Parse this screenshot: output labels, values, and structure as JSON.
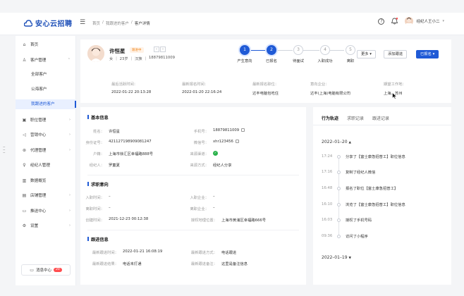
{
  "app": {
    "logo_text": "安心云招聘"
  },
  "breadcrumb": [
    "首页",
    "我跟进的客户",
    "客户详情"
  ],
  "topbar": {
    "user_name": "经纪人王小二"
  },
  "sidebar": {
    "items": [
      {
        "label": "首页",
        "icon": "home-icon"
      },
      {
        "label": "客户管理",
        "icon": "user-icon",
        "chevron": "^"
      },
      {
        "label": "职位管理",
        "icon": "briefcase-icon",
        "chevron": ">"
      },
      {
        "label": "营销中心",
        "icon": "megaphone-icon",
        "chevron": ">"
      },
      {
        "label": "代理管理",
        "icon": "agent-icon",
        "chevron": ">"
      },
      {
        "label": "经纪人管理",
        "icon": "person-icon",
        "chevron": ">"
      },
      {
        "label": "数据概览",
        "icon": "chart-icon"
      },
      {
        "label": "店铺管理",
        "icon": "store-icon",
        "chevron": ">"
      },
      {
        "label": "推送中心",
        "icon": "push-icon",
        "chevron": ">"
      },
      {
        "label": "设置",
        "icon": "gear-icon",
        "chevron": ">"
      }
    ],
    "sub_items": [
      "全部客户",
      "公海客户",
      "我跟进的客户"
    ],
    "message_center": {
      "label": "消息中心",
      "badge": "20"
    }
  },
  "candidate": {
    "name": "许恒星",
    "status_tag": "跟进中",
    "gender": "女",
    "age": "23岁",
    "ethnicity": "汉族",
    "phone": "18879811009"
  },
  "steps": [
    {
      "num": "1",
      "label": "产生意向",
      "done": true
    },
    {
      "num": "2",
      "label": "已报名",
      "done": true
    },
    {
      "num": "3",
      "label": "待面试",
      "done": false
    },
    {
      "num": "4",
      "label": "入职成功",
      "done": false
    },
    {
      "num": "5",
      "label": "离职",
      "done": false
    }
  ],
  "actions": {
    "more": "更多",
    "add_follow": "添加跟进",
    "signed_up": "已报名"
  },
  "meta": [
    {
      "k": "最后活跃时间：",
      "v": "2022-01-22 20:13:28"
    },
    {
      "k": "最新报名时间：",
      "v": "2022-01-20 22:16:24"
    },
    {
      "k": "最新报名职位：",
      "v": "达丰电脑包吃住"
    },
    {
      "k": "意向企业：",
      "v": "达丰(上海)电脑有限公司"
    },
    {
      "k": "期望工作地：",
      "v": "上海、苏州"
    }
  ],
  "basic_info": {
    "title": "基本信息",
    "left": [
      {
        "k": "姓名：",
        "v": "许恒星"
      },
      {
        "k": "身份证号：",
        "v": "421127198909081247"
      },
      {
        "k": "户籍：",
        "v": "上海市徐汇区幸福路888号"
      },
      {
        "k": "经纪人：",
        "v": "罗童夏"
      }
    ],
    "right": [
      {
        "k": "手机号：",
        "v": "18879811009"
      },
      {
        "k": "微信号：",
        "v": "xhr123456"
      },
      {
        "k": "来源渠道：",
        "v": ""
      },
      {
        "k": "来源方式：",
        "v": "经纪人分享"
      }
    ]
  },
  "job_intent": {
    "title": "求职意向",
    "left": [
      {
        "k": "入职时间：",
        "v": "–"
      },
      {
        "k": "离职时间：",
        "v": "–"
      },
      {
        "k": "创建时间：",
        "v": "2021-12-23 00:12:38"
      }
    ],
    "right": [
      {
        "k": "入职企业：",
        "v": "–"
      },
      {
        "k": "离职企业：",
        "v": "–"
      },
      {
        "k": "授权地理位置：",
        "v": "上海市黄浦区幸福路666号"
      }
    ]
  },
  "follow_info": {
    "title": "跟进信息",
    "rows": [
      {
        "k1": "最新跟进时间：",
        "v1": "2022-01-21 16:08:19",
        "k2": "最新跟进方式：",
        "v2": "电话跟进"
      },
      {
        "k1": "最新跟进结果：",
        "v1": "电话未打通",
        "k2": "最新跟进备注：",
        "v2": "这里是备注信息"
      }
    ]
  },
  "trace": {
    "tabs": [
      "行为轨迹",
      "求职记录",
      "跟进记录"
    ],
    "groups": [
      {
        "date": "2022–01–20",
        "items": [
          {
            "time": "17:24",
            "text": "分享了【富士康急招普工】职位信息"
          },
          {
            "time": "17:16",
            "text": "复制了经纪人微信"
          },
          {
            "time": "16:48",
            "text": "报名了职位【富士康急招普工】"
          },
          {
            "time": "16:10",
            "text": "浏览了【富士康急招普工】职位信息"
          },
          {
            "time": "16:03",
            "text": "授权了手机号码"
          },
          {
            "time": "09:36",
            "text": "访问了小程序"
          }
        ]
      },
      {
        "date": "2022–01–19",
        "items": []
      }
    ]
  }
}
